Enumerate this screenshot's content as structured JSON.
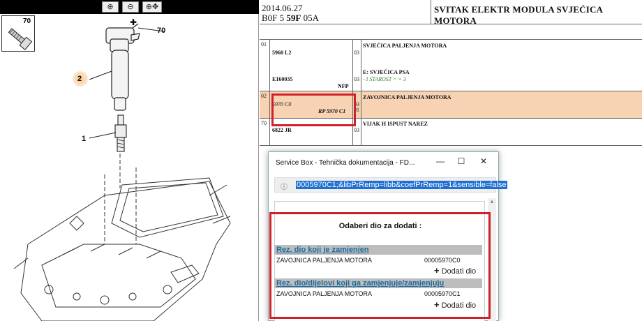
{
  "diagram": {
    "callouts": [
      "70",
      "70",
      "2",
      "1"
    ],
    "toolbar_icons": [
      "zoom-in-icon",
      "zoom-out-icon",
      "zoom-fit-icon"
    ]
  },
  "doc": {
    "date": "2014.06.27",
    "code_prefix": "B0F 5",
    "code_bold": "59F",
    "code_suffix": "05A",
    "title": "SVITAK ELEKTR MODULA SVJEĆICA MOTORA",
    "rows": [
      {
        "num": "01",
        "ref": "5960 L2",
        "qty": "03",
        "desc": "SVJEĆICA PALJENJA MOTORA"
      },
      {
        "num": "",
        "ref": "E160035",
        "nfp": "NFP",
        "qty": "03",
        "desc": "E: SVJEĆICA PSA",
        "note": "- I STAROST > = 3"
      },
      {
        "num": "02",
        "ref": "5970 C0",
        "ref2": "RP 5970 C1",
        "qty": "03",
        "qty2": "01",
        "desc": "ZAVOJNICA PALJENJA MOTORA"
      },
      {
        "num": "70",
        "ref": "6822 JR",
        "qty": "03",
        "desc": "VIJAK H ISPUST NAREZ"
      }
    ]
  },
  "popup": {
    "title": "Service Box - Tehnička dokumentacija - FD...",
    "controls": [
      "—",
      "☐",
      "✕"
    ],
    "url": "0005970C1;&libPrRemp=libb&coefPrRemp=1&sensible=false",
    "select_title": "Odaberi dio za dodati :",
    "section1": "Rez. dio koji je zamjenjen",
    "section2": "Rez. dio/dijelovi koji ga zamjenjuje/zamjenjuju",
    "parts": [
      {
        "name": "ZAVOJNICA PALJENJA MOTORA",
        "code": "00005970C0",
        "add": "Dodati dio"
      },
      {
        "name": "ZAVOJNICA PALJENJA MOTORA",
        "code": "00005970C1",
        "add": "Dodati dio"
      }
    ]
  },
  "colors": {
    "highlight_row": "#f7d3b4",
    "red_box": "#d0202a",
    "section_header_bg": "#bdbdbd",
    "section_header_text": "#1a6aa0",
    "url_select": "#1e6fd0"
  }
}
